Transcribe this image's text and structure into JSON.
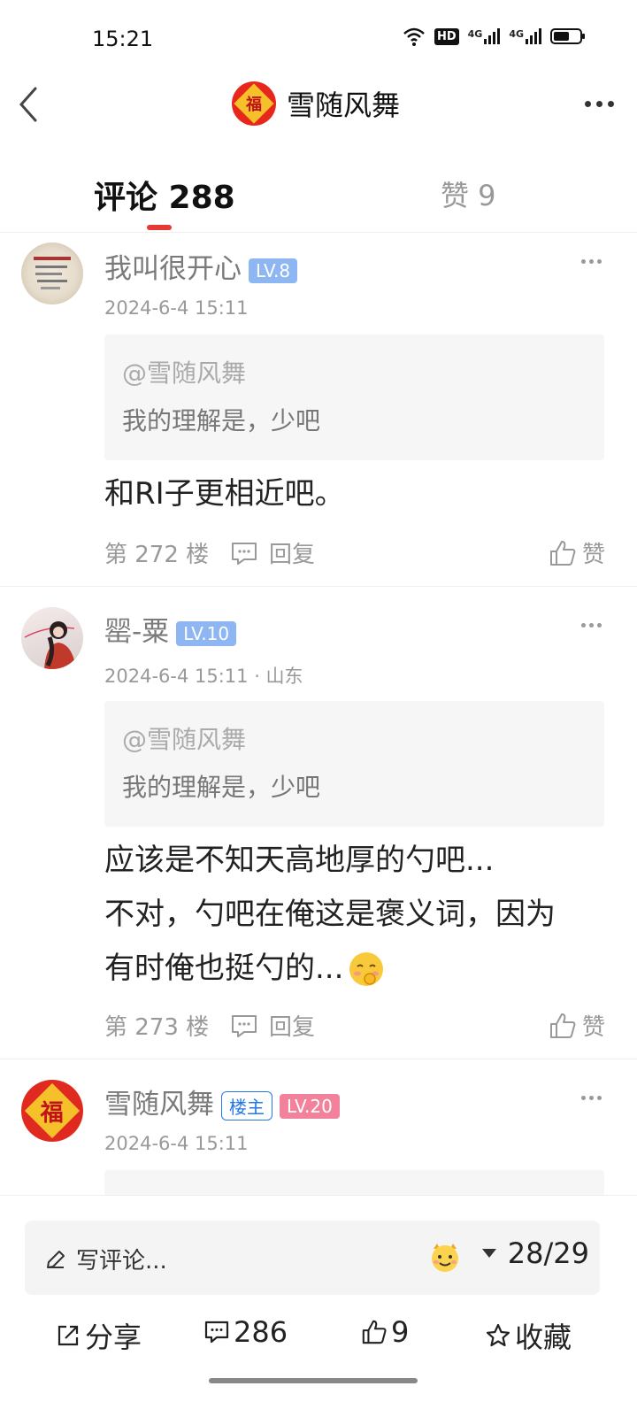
{
  "status": {
    "time": "15:21",
    "hd_label": "HD",
    "net1": "4G",
    "net2": "4G"
  },
  "header": {
    "title": "雪随风舞",
    "avatar_char": "福"
  },
  "tabs": {
    "comments": "评论 288",
    "likes": "赞 9"
  },
  "comments": [
    {
      "user": "我叫很开心",
      "level": "LV.8",
      "time": "2024-6-4 15:11",
      "quote_user": "@雪随风舞",
      "quote_text": "我的理解是，少吧",
      "body": [
        "和RI子更相近吧。"
      ],
      "floor": "第 272 楼",
      "reply": "回复",
      "like": "赞"
    },
    {
      "user": "罂-粟",
      "level": "LV.10",
      "time": "2024-6-4 15:11 · 山东",
      "quote_user": "@雪随风舞",
      "quote_text": "我的理解是，少吧",
      "body": [
        "应该是不知天高地厚的勺吧...",
        "不对，勺吧在俺这是褒义词，因为",
        "有时俺也挺勺的..."
      ],
      "floor": "第 273 楼",
      "reply": "回复",
      "like": "赞"
    },
    {
      "user": "雪随风舞",
      "owner_badge": "楼主",
      "level": "LV.20",
      "time": "2024-6-4 15:11",
      "avatar_char": "福"
    }
  ],
  "bottom": {
    "placeholder": "写评论...",
    "page": "28/29",
    "share": "分享",
    "comments_count": "286",
    "likes_count": "9",
    "favorite": "收藏"
  }
}
